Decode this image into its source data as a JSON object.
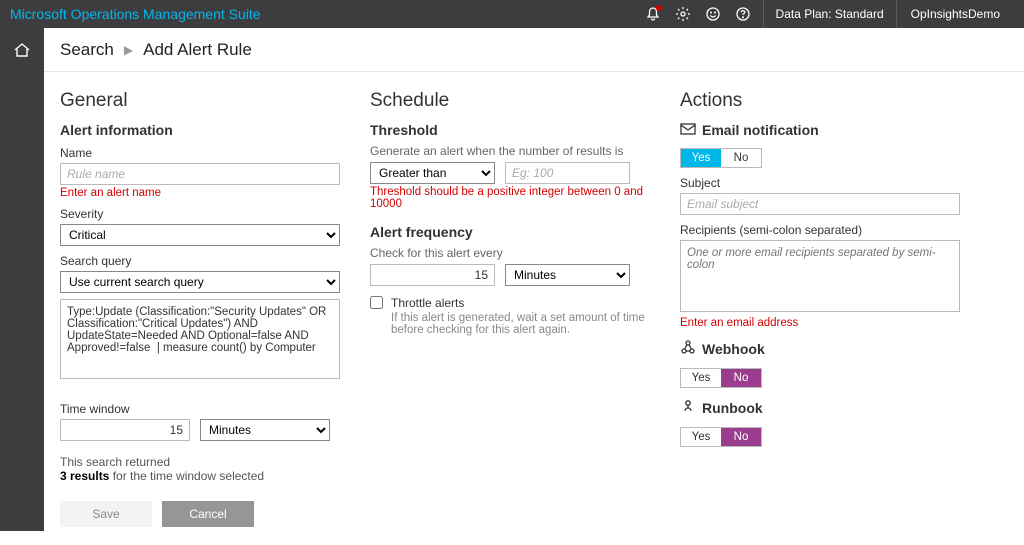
{
  "topbar": {
    "title": "Microsoft Operations Management Suite",
    "plan_label": "Data Plan:",
    "plan_value": "Standard",
    "user": "OpInsightsDemo"
  },
  "breadcrumb": {
    "root": "Search",
    "current": "Add Alert Rule"
  },
  "general": {
    "title": "General",
    "section": "Alert information",
    "name_label": "Name",
    "name_placeholder": "Rule name",
    "name_error": "Enter an alert name",
    "severity_label": "Severity",
    "severity_value": "Critical",
    "query_label": "Search query",
    "query_select": "Use current search query",
    "query_text": "Type:Update (Classification:\"Security Updates\" OR Classification:\"Critical Updates\") AND UpdateState=Needed AND Optional=false AND Approved!=false  | measure count() by Computer",
    "window_label": "Time window",
    "window_value": "15",
    "window_unit": "Minutes",
    "summary_pref": "This search returned",
    "summary_count": "3 results",
    "summary_suffix": " for the time window selected",
    "save": "Save",
    "cancel": "Cancel"
  },
  "schedule": {
    "title": "Schedule",
    "threshold": "Threshold",
    "threshold_desc": "Generate an alert when the number of results is",
    "threshold_op": "Greater than",
    "threshold_ph": "Eg: 100",
    "threshold_err": "Threshold should be a positive integer between 0 and 10000",
    "freq_title": "Alert frequency",
    "freq_desc": "Check for this alert every",
    "freq_value": "15",
    "freq_unit": "Minutes",
    "throttle_label": "Throttle alerts",
    "throttle_desc": "If this alert is generated, wait a set amount of time before checking for this alert again."
  },
  "actions": {
    "title": "Actions",
    "email_header": "Email notification",
    "yes": "Yes",
    "no": "No",
    "subject_label": "Subject",
    "subject_ph": "Email subject",
    "recipients_label": "Recipients (semi-colon separated)",
    "recipients_ph": "One or more email recipients separated by semi-colon",
    "recipients_err": "Enter an email address",
    "webhook": "Webhook",
    "runbook": "Runbook"
  }
}
